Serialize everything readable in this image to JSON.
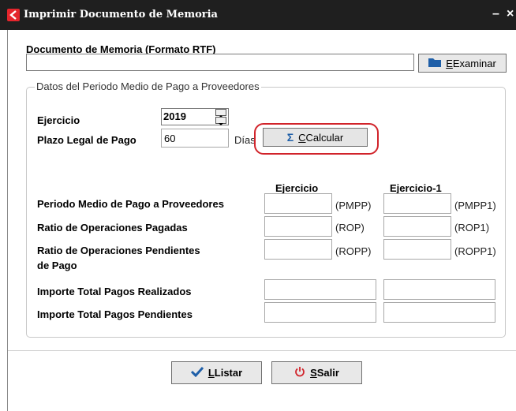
{
  "window": {
    "title": "Imprimir Documento de Memoria",
    "minimize_glyph": "–",
    "close_glyph": "×"
  },
  "document": {
    "label": "Documento de Memoria (Formato RTF)",
    "path_value": "",
    "browse_icon": "folder-icon",
    "browse_label": "Examinar",
    "browse_mnemonic": "E"
  },
  "period_group": {
    "title": "Datos del Periodo Medio de Pago a Proveedores",
    "ejercicio_label": "Ejercicio",
    "ejercicio_value": "2019",
    "plazo_label": "Plazo Legal de Pago",
    "plazo_value": "60",
    "plazo_unit": "Días",
    "calc_icon": "sigma-icon",
    "calc_label": "Calcular",
    "calc_mnemonic": "C",
    "col_current": "Ejercicio",
    "col_previous": "Ejercicio-1",
    "rows": [
      {
        "label": "Periodo Medio de Pago a Proveedores",
        "current_value": "",
        "current_suffix": "(PMPP)",
        "previous_value": "",
        "previous_suffix": "(PMPP1)"
      },
      {
        "label": "Ratio de Operaciones Pagadas",
        "current_value": "",
        "current_suffix": "(ROP)",
        "previous_value": "",
        "previous_suffix": "(ROP1)"
      },
      {
        "label_line1": "Ratio de Operaciones Pendientes",
        "label_line2": "de Pago",
        "current_value": "",
        "current_suffix": "(ROPP)",
        "previous_value": "",
        "previous_suffix": "(ROPP1)"
      },
      {
        "label": "Importe Total Pagos Realizados",
        "current_value": "",
        "previous_value": ""
      },
      {
        "label": "Importe Total Pagos Pendientes",
        "current_value": "",
        "previous_value": ""
      }
    ]
  },
  "footer": {
    "listar_icon": "checkmark-icon",
    "listar_label": "Listar",
    "listar_mnemonic": "L",
    "salir_icon": "power-icon",
    "salir_label": "Salir",
    "salir_mnemonic": "S"
  },
  "colors": {
    "titlebar": "#1f1f1f",
    "app_icon": "#e5252c",
    "highlight": "#d1232a",
    "folder": "#1f5fa8",
    "check": "#1f5fa8",
    "power": "#d1232a"
  }
}
